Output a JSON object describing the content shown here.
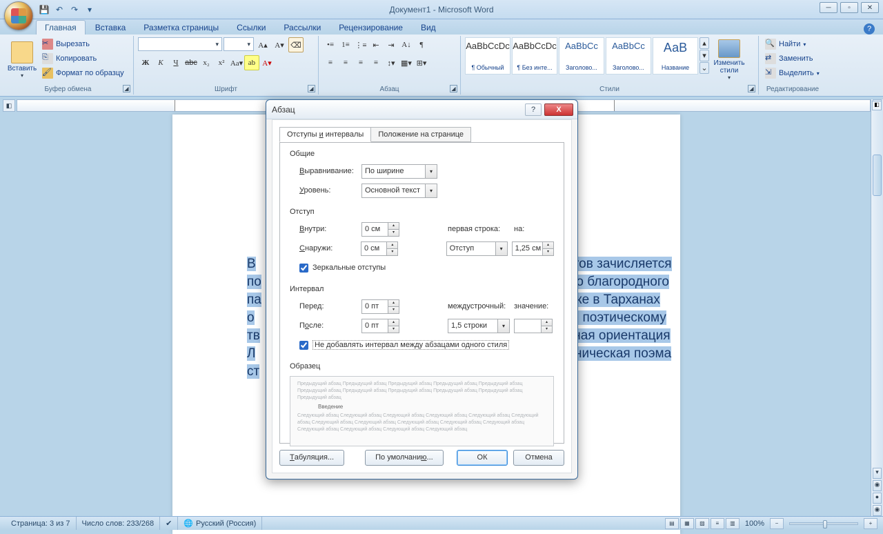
{
  "window": {
    "title": "Документ1 - Microsoft Word"
  },
  "tabs": {
    "t0": "Главная",
    "t1": "Вставка",
    "t2": "Разметка страницы",
    "t3": "Ссылки",
    "t4": "Рассылки",
    "t5": "Рецензирование",
    "t6": "Вид"
  },
  "clipboard": {
    "paste": "Вставить",
    "cut": "Вырезать",
    "copy": "Копировать",
    "painter": "Формат по образцу",
    "group": "Буфер обмена"
  },
  "font": {
    "group": "Шрифт",
    "family": "",
    "size": ""
  },
  "para": {
    "group": "Абзац"
  },
  "styles": {
    "group": "Стили",
    "s0": {
      "preview": "AaBbCcDc",
      "name": "¶ Обычный"
    },
    "s1": {
      "preview": "AaBbCcDc",
      "name": "¶ Без инте..."
    },
    "s2": {
      "preview": "AaBbCc",
      "name": "Заголово..."
    },
    "s3": {
      "preview": "AaBbCc",
      "name": "Заголово..."
    },
    "s4": {
      "preview": "АаВ",
      "name": "Название"
    },
    "change": "Изменить стили"
  },
  "editing": {
    "group": "Редактирование",
    "find": "Найти",
    "replace": "Заменить",
    "select": "Выделить"
  },
  "dialog": {
    "title": "Абзац",
    "tab0": "Отступы и интервалы",
    "tab0_u": "и",
    "tab1": "Положение на странице",
    "sect_general": "Общие",
    "align_label": "Выравнивание:",
    "align_u": "В",
    "align_val": "По ширине",
    "level_label": "Уровень:",
    "level_u": "У",
    "level_val": "Основной текст",
    "sect_indent": "Отступ",
    "inside_label": "Внутри:",
    "inside_u": "В",
    "inside_val": "0 см",
    "outside_label": "Снаружи:",
    "outside_u": "С",
    "outside_val": "0 см",
    "first_label": "первая строка:",
    "first_u": "п",
    "first_val": "Отступ",
    "by_label": "на:",
    "by_u": "н",
    "by_val": "1,25 см",
    "mirror": "Зеркальные отступы",
    "mirror_u": "З",
    "sect_spacing": "Интервал",
    "before_label": "Перед:",
    "before_u": "П",
    "before_val": "0 пт",
    "after_label": "После:",
    "after_u": "П",
    "after_val": "0 пт",
    "line_label": "междустрочный:",
    "line_u": "м",
    "line_val": "1,5 строки",
    "at_label": "значение:",
    "at_u": "з",
    "at_val": "",
    "nospace": "Не добавлять интервал между абзацами одного стиля",
    "sect_preview": "Образец",
    "preview_text": "Предыдущий абзац Предыдущий абзац Предыдущий абзац Предыдущий абзац Предыдущий абзац Предыдущий абзац Предыдущий абзац Предыдущий абзац Предыдущий абзац Предыдущий абзац Предыдущий абзац",
    "preview_mid": "Введение",
    "preview_after": "Следующий абзац Следующий абзац Следующий абзац Следующий абзац Следующий абзац Следующий абзац Следующий абзац Следующий абзац Следующий абзац Следующий абзац Следующий абзац Следующий абзац Следующий абзац Следующий абзац Следующий абзац",
    "btn_tabs": "Табуляция...",
    "btn_tabs_u": "Т",
    "btn_default": "По умолчанию...",
    "btn_default_u": "ю",
    "btn_ok": "ОК",
    "btn_cancel": "Отмена"
  },
  "doc": {
    "l1a": "В",
    "l1b": "тов зачисляется",
    "l2a": "по",
    "l2b": "го благородного",
    "l3a": "па",
    "l3b": "же в Тарханах",
    "l4a": "о",
    "l4b": "и поэтическому",
    "l5a": "тв",
    "l5b": "нная ориентация",
    "l6a": "Л",
    "l6b": "оническая поэма",
    "l7a": "ст"
  },
  "status": {
    "page": "Страница: 3 из 7",
    "words": "Число слов: 233/268",
    "lang": "Русский (Россия)",
    "zoom": "100%"
  }
}
